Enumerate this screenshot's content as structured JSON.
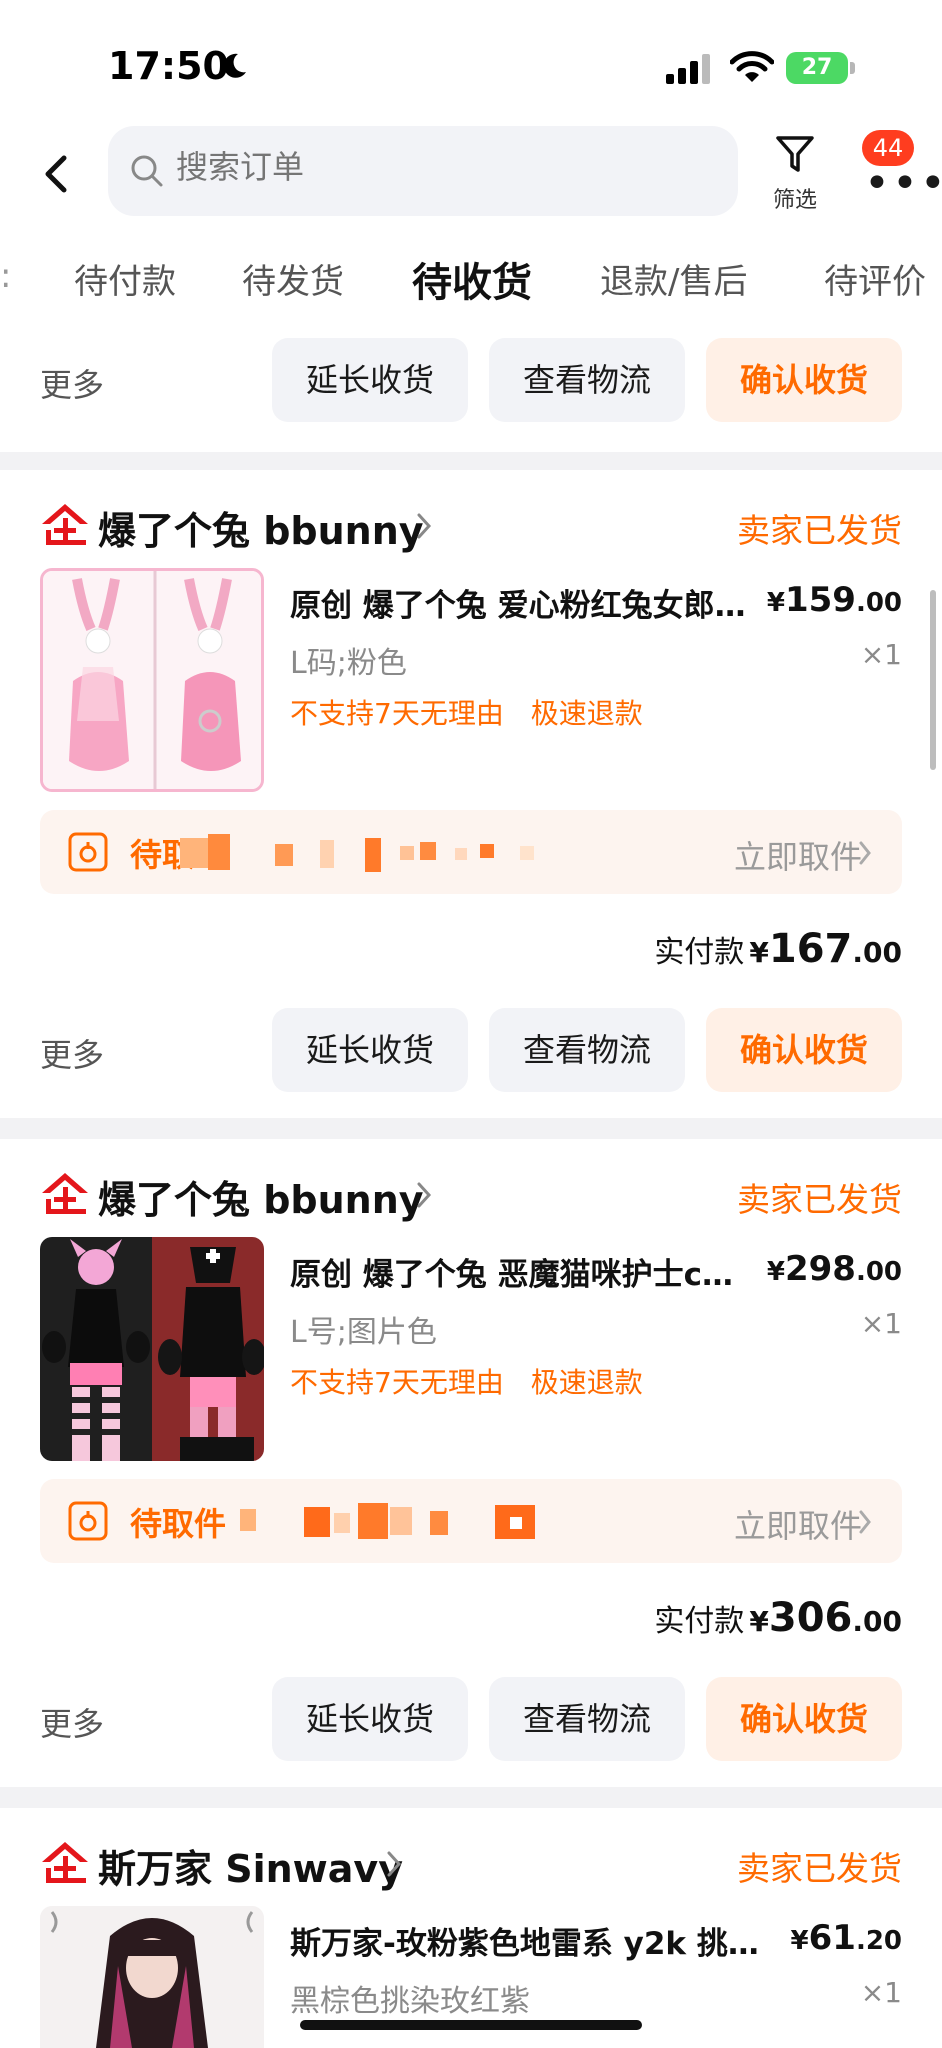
{
  "status_bar": {
    "time": "17:50",
    "battery": "27"
  },
  "header": {
    "search_placeholder": "搜索订单",
    "filter_label": "筛选",
    "message_badge": "44"
  },
  "tabs": [
    "待付款",
    "待发货",
    "待收货",
    "退款/售后",
    "待评价"
  ],
  "active_tab": "待收货",
  "actions": {
    "more": "更多",
    "extend": "延长收货",
    "logistics": "查看物流",
    "confirm": "确认收货"
  },
  "orders": [
    {
      "shop_name": "爆了个兔 bbunny",
      "status": "卖家已发货",
      "title": "原创 爆了个兔 爱心粉红兔女郎…",
      "price_symbol": "¥",
      "price_int": "159",
      "price_dec": ".00",
      "sku": "L码;粉色",
      "qty": "×1",
      "tags": [
        "不支持7天无理由",
        "极速退款"
      ],
      "pickup_label": "待取",
      "pickup_link": "立即取件",
      "paid_label": "实付款",
      "paid_symbol": "¥",
      "paid_int": "167",
      "paid_dec": ".00"
    },
    {
      "shop_name": "爆了个兔 bbunny",
      "status": "卖家已发货",
      "title": "原创 爆了个兔 恶魔猫咪护士c…",
      "price_symbol": "¥",
      "price_int": "298",
      "price_dec": ".00",
      "sku": "L号;图片色",
      "qty": "×1",
      "tags": [
        "不支持7天无理由",
        "极速退款"
      ],
      "pickup_label": "待取件",
      "pickup_link": "立即取件",
      "paid_label": "实付款",
      "paid_symbol": "¥",
      "paid_int": "306",
      "paid_dec": ".00"
    },
    {
      "shop_name": "斯万家 Sinwavy",
      "status": "卖家已发货",
      "title": "斯万家-玫粉紫色地雷系 y2k 挑染…",
      "price_symbol": "¥",
      "price_int": "61",
      "price_dec": ".20",
      "sku": "黑棕色挑染玫红紫",
      "qty": "×1"
    }
  ],
  "colors": {
    "accent": "#ff6a00",
    "brand_red": "#e4161b",
    "badge": "#ff3d1f"
  }
}
